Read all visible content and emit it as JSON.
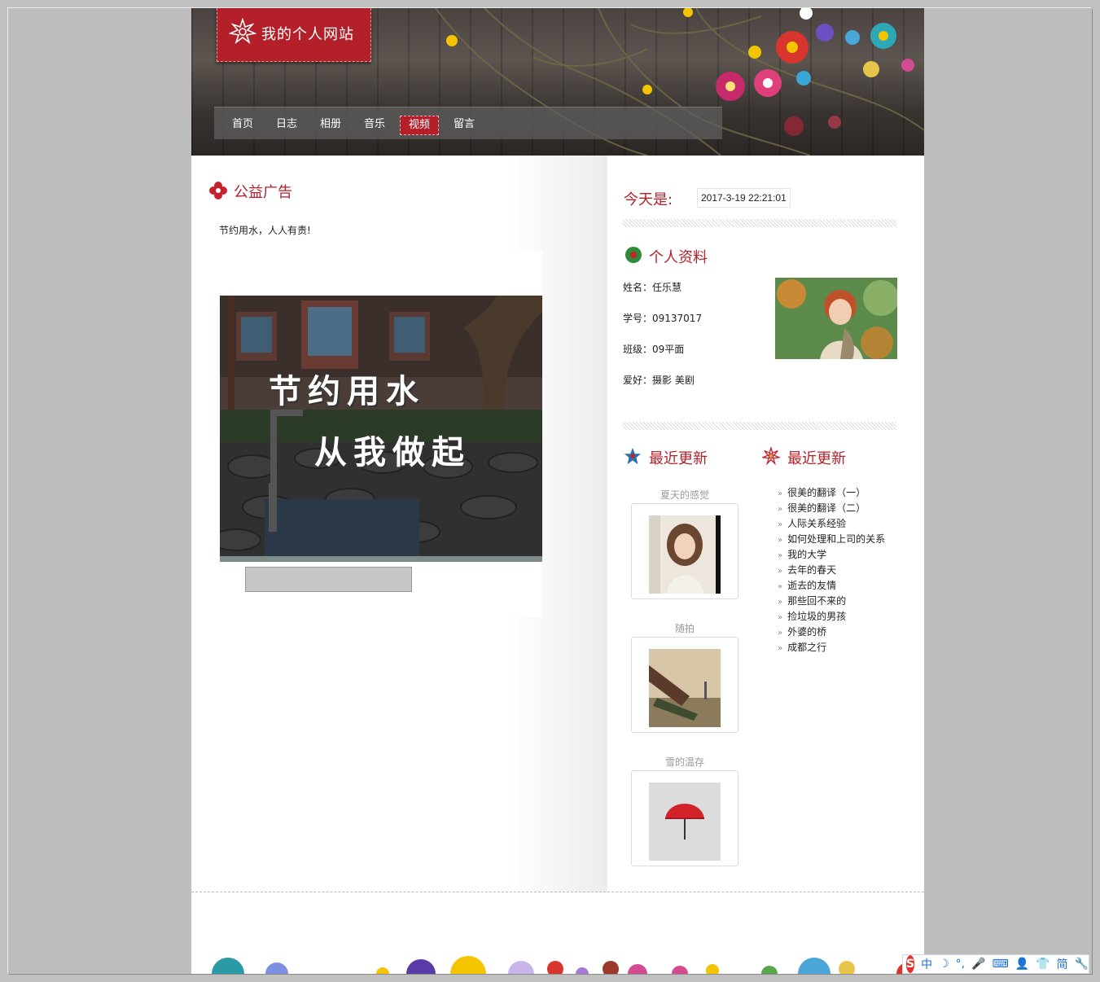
{
  "site": {
    "logo_text": "我的个人网站"
  },
  "nav": {
    "items": [
      {
        "label": "首页"
      },
      {
        "label": "日志"
      },
      {
        "label": "相册"
      },
      {
        "label": "音乐"
      },
      {
        "label": "视频",
        "active": true
      },
      {
        "label": "留言"
      }
    ]
  },
  "ad": {
    "title": "公益广告",
    "text": "节约用水，人人有责!",
    "video_caption_line1": "节约用水",
    "video_caption_line2": "从我做起"
  },
  "today": {
    "label": "今天是:",
    "value": "2017-3-19 22:21:01"
  },
  "profile": {
    "title": "个人资料",
    "rows": [
      {
        "text": "姓名：任乐慧"
      },
      {
        "text": "学号：09137017"
      },
      {
        "text": "班级：09平面"
      },
      {
        "text": "爱好：摄影 美剧"
      }
    ]
  },
  "recent_photos": {
    "title": "最近更新",
    "items": [
      {
        "caption": "夏天的感觉"
      },
      {
        "caption": "随拍"
      },
      {
        "caption": "雪的温存"
      }
    ]
  },
  "recent_posts": {
    "title": "最近更新",
    "items": [
      {
        "label": "很美的翻译（一）"
      },
      {
        "label": "很美的翻译（二）"
      },
      {
        "label": "人际关系经验"
      },
      {
        "label": "如何处理和上司的关系"
      },
      {
        "label": "我的大学"
      },
      {
        "label": "去年的春天"
      },
      {
        "label": "逝去的友情"
      },
      {
        "label": "那些回不来的"
      },
      {
        "label": "捡垃圾的男孩"
      },
      {
        "label": "外婆的桥"
      },
      {
        "label": "成都之行"
      }
    ]
  },
  "ime": {
    "items": [
      "S",
      "中",
      "☽",
      "°,",
      "🎤",
      "⌨",
      "👤",
      "👕",
      "简",
      "🔧"
    ]
  },
  "colors": {
    "accent": "#b3202a",
    "page_bg": "#c0c0c0"
  }
}
